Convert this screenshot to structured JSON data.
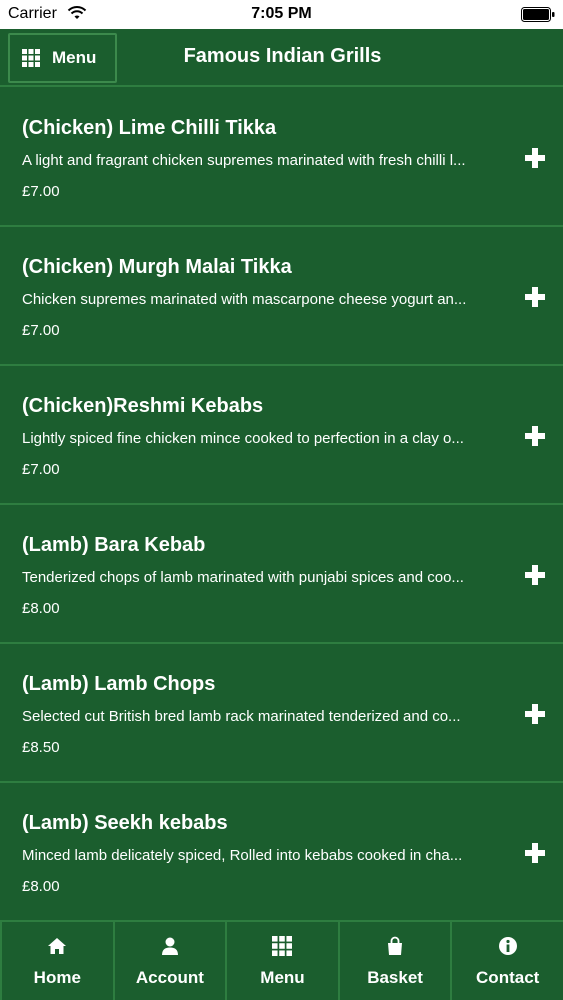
{
  "status": {
    "carrier": "Carrier",
    "time": "7:05 PM"
  },
  "header": {
    "menu_label": "Menu",
    "title": "Famous Indian Grills"
  },
  "items": [
    {
      "name": "(Chicken) Lime Chilli Tikka",
      "desc": "A light and fragrant chicken supremes marinated with fresh chilli l...",
      "price": "£7.00"
    },
    {
      "name": "(Chicken) Murgh Malai Tikka",
      "desc": "Chicken supremes marinated with mascarpone cheese yogurt an...",
      "price": "£7.00"
    },
    {
      "name": "(Chicken)Reshmi Kebabs",
      "desc": "Lightly spiced fine chicken mince cooked to perfection in a clay o...",
      "price": "£7.00"
    },
    {
      "name": "(Lamb) Bara Kebab",
      "desc": "Tenderized chops of lamb marinated with punjabi spices and coo...",
      "price": "£8.00"
    },
    {
      "name": "(Lamb) Lamb Chops",
      "desc": "Selected cut British bred lamb rack marinated tenderized and co...",
      "price": "£8.50"
    },
    {
      "name": "(Lamb) Seekh kebabs",
      "desc": "Minced lamb delicately spiced, Rolled into kebabs cooked in cha...",
      "price": "£8.00"
    }
  ],
  "tabs": [
    {
      "label": "Home",
      "icon": "home-icon"
    },
    {
      "label": "Account",
      "icon": "user-icon"
    },
    {
      "label": "Menu",
      "icon": "grid-icon"
    },
    {
      "label": "Basket",
      "icon": "basket-icon"
    },
    {
      "label": "Contact",
      "icon": "info-icon"
    }
  ],
  "colors": {
    "background": "#1b5e2e",
    "divider": "#2e7d40",
    "text": "#ffffff"
  }
}
